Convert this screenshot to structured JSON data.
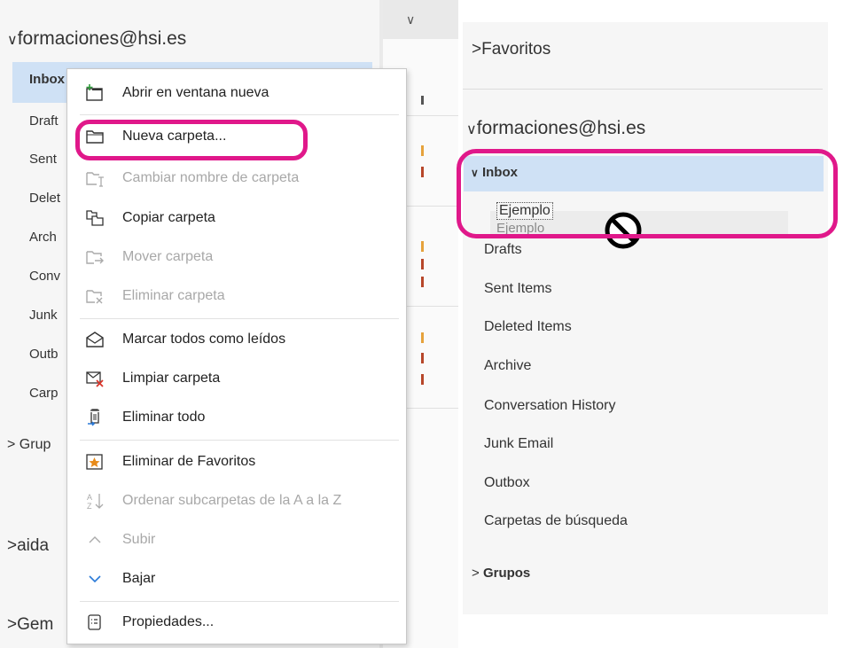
{
  "left_pane": {
    "account": "formaciones@hsi.es",
    "folders": [
      "Inbox",
      "Draft",
      "Sent",
      "Delet",
      "Arch",
      "Conv",
      "Junk",
      "Outb",
      "Carp"
    ],
    "groups_label": "Grup",
    "other_accounts": [
      "aida",
      "Gem"
    ]
  },
  "context_menu": {
    "items": [
      {
        "label": "Abrir en ventana nueva",
        "icon": "new-window-icon",
        "enabled": true
      },
      {
        "label": "Nueva carpeta...",
        "icon": "new-folder-icon",
        "enabled": true
      },
      {
        "label": "Cambiar nombre de carpeta",
        "icon": "rename-folder-icon",
        "enabled": false
      },
      {
        "label": "Copiar carpeta",
        "icon": "copy-folder-icon",
        "enabled": true
      },
      {
        "label": "Mover carpeta",
        "icon": "move-folder-icon",
        "enabled": false
      },
      {
        "label": "Eliminar carpeta",
        "icon": "delete-folder-icon",
        "enabled": false
      },
      {
        "label": "Marcar todos como leídos",
        "icon": "mark-read-icon",
        "enabled": true
      },
      {
        "label": "Limpiar carpeta",
        "icon": "clean-folder-icon",
        "enabled": true
      },
      {
        "label": "Eliminar todo",
        "icon": "delete-all-icon",
        "enabled": true
      },
      {
        "label": "Eliminar de Favoritos",
        "icon": "favorite-remove-icon",
        "enabled": true
      },
      {
        "label": "Ordenar subcarpetas de la A a la Z",
        "icon": "sort-az-icon",
        "enabled": false
      },
      {
        "label": "Subir",
        "icon": "chevron-up-icon",
        "enabled": false
      },
      {
        "label": "Bajar",
        "icon": "chevron-down-icon",
        "enabled": true
      },
      {
        "label": "Propiedades...",
        "icon": "properties-icon",
        "enabled": true
      }
    ]
  },
  "right_pane": {
    "favorites_label": "Favoritos",
    "account": "formaciones@hsi.es",
    "inbox": "Inbox",
    "new_folder": "Ejemplo",
    "drag_ghost": "Ejemplo",
    "folders": [
      "Drafts",
      "Sent Items",
      "Deleted Items",
      "Archive",
      "Conversation History",
      "Junk Email",
      "Outbox",
      "Carpetas de búsqueda"
    ],
    "groups_label": "Grupos"
  },
  "colors": {
    "highlight": "#e0188a",
    "selection": "#cfe1f5",
    "pane_bg": "#f6f6f6"
  }
}
